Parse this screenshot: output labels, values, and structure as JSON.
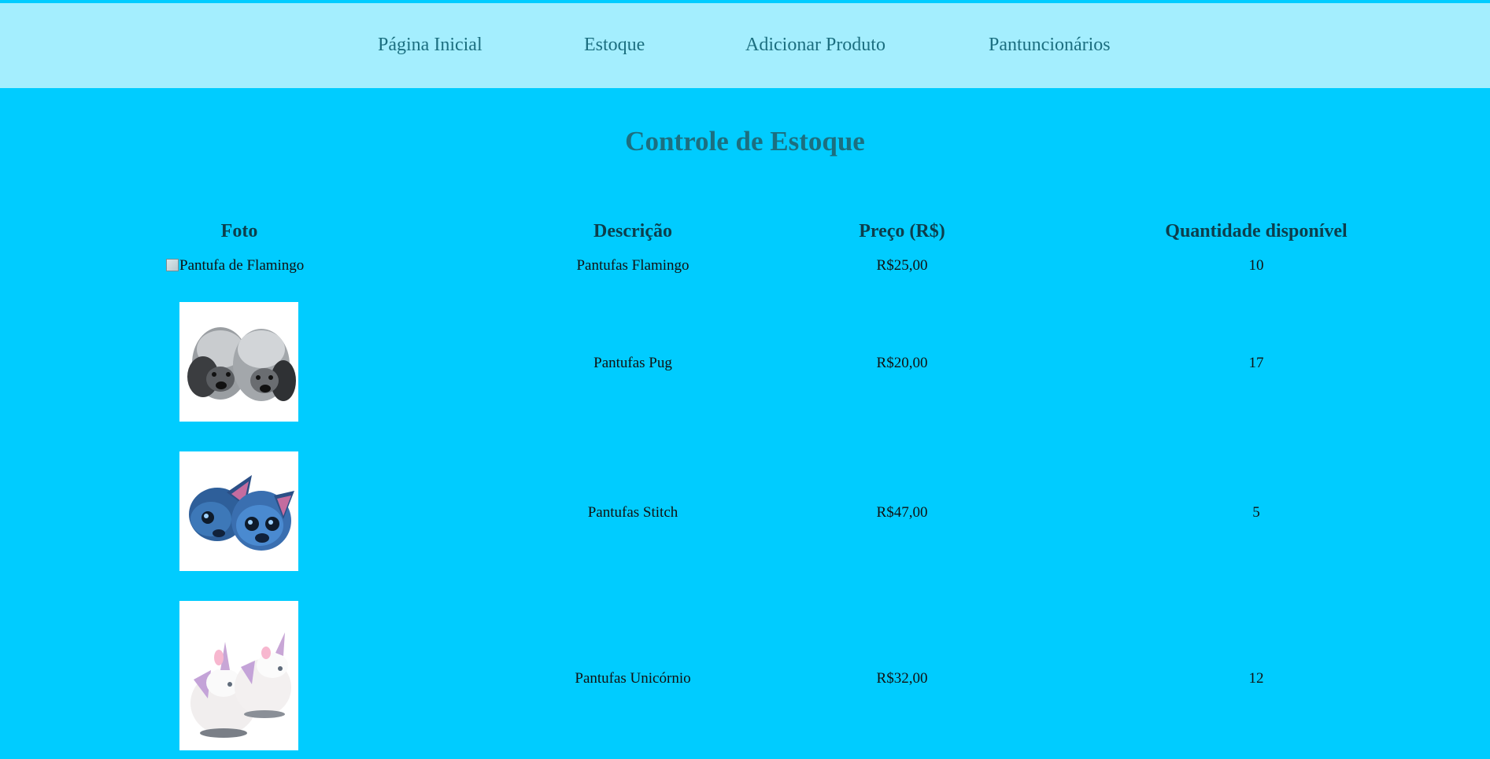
{
  "nav": {
    "items": [
      {
        "label": "Página Inicial"
      },
      {
        "label": "Estoque"
      },
      {
        "label": "Adicionar Produto"
      },
      {
        "label": "Pantuncionários"
      }
    ]
  },
  "page_title": "Controle de Estoque",
  "table": {
    "headers": [
      "Foto",
      "Descrição",
      "Preço (R$)",
      "Quantidade disponível"
    ],
    "rows": [
      {
        "photo_alt": "Pantufa de Flamingo",
        "photo_icon": "broken-image-icon",
        "description": "Pantufas Flamingo",
        "price": "R$25,00",
        "quantity": "10"
      },
      {
        "photo_icon": "pug-slippers-image",
        "description": "Pantufas Pug",
        "price": "R$20,00",
        "quantity": "17"
      },
      {
        "photo_icon": "stitch-slippers-image",
        "description": "Pantufas Stitch",
        "price": "R$47,00",
        "quantity": "5"
      },
      {
        "photo_icon": "unicorn-slippers-image",
        "description": "Pantufas Unicórnio",
        "price": "R$32,00",
        "quantity": "12"
      }
    ]
  },
  "colors": {
    "background": "#00ccff",
    "nav_background": "#a4eefe",
    "nav_text": "#1c6f80",
    "title_text": "#1c6f80",
    "header_text": "#0d3e4c"
  }
}
